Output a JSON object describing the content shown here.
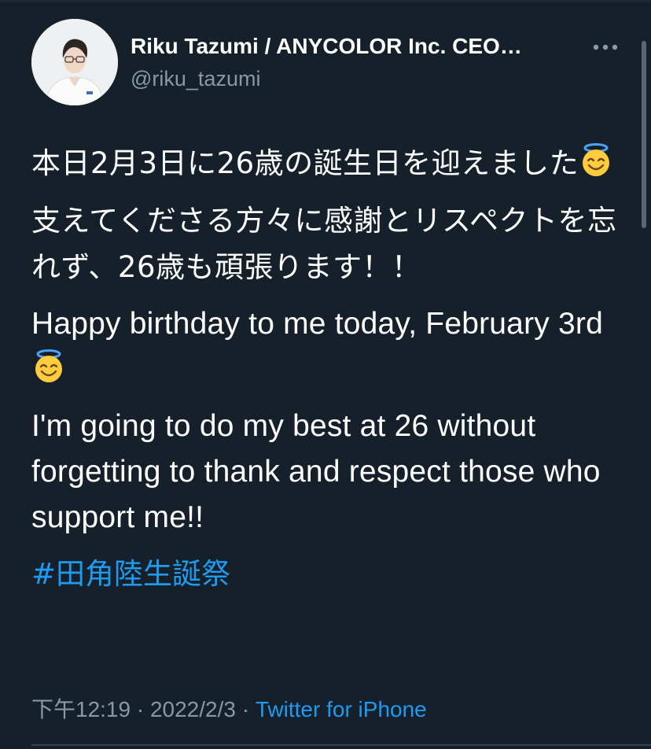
{
  "tweet": {
    "author": {
      "display_name": "Riku Tazumi / ANYCOLOR Inc. CEO…",
      "handle": "@riku_tazumi",
      "avatar": "profile-photo"
    },
    "more_icon": "more-horizontal-icon",
    "paragraphs_ja": [
      "本日2月3日に26歳の誕生日を迎えました",
      "支えてくださる方々に感謝とリスペクトを忘れず、26歳も頑張ります！！"
    ],
    "paragraph_en_1": "Happy birthday to me today, February 3rd",
    "paragraph_en_2": "I'm going to do my best at 26 without forgetting to thank and respect those who support me!!",
    "emoji": "smiling-face-with-halo",
    "hashtag": "#田角陸生誕祭",
    "timestamp": "下午12:19",
    "separator": "·",
    "date": "2022/2/3",
    "source": "Twitter for iPhone"
  },
  "colors": {
    "background": "#15202b",
    "text": "#ffffff",
    "secondary": "#8899a6",
    "link": "#1d9bf0"
  }
}
